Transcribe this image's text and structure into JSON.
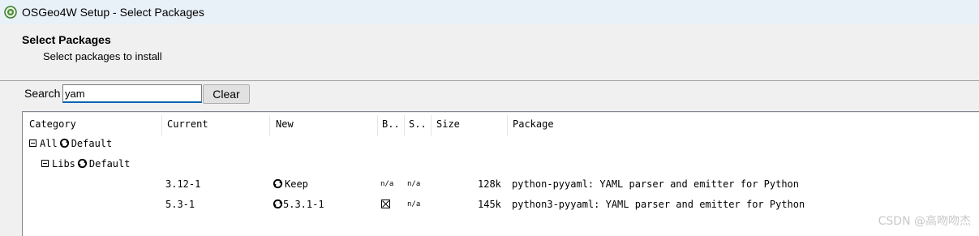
{
  "window": {
    "title": "OSGeo4W Setup - Select Packages",
    "icon": "osgeo4w-logo-icon"
  },
  "header": {
    "title": "Select Packages",
    "subtitle": "Select packages to install"
  },
  "search": {
    "label": "Search",
    "value": "yam",
    "clear_label": "Clear"
  },
  "columns": [
    "Category",
    "Current",
    "New",
    "B..",
    "S..",
    "Size",
    "Package"
  ],
  "tree": [
    {
      "label": "All",
      "action": "Default"
    },
    {
      "label": "Libs",
      "action": "Default"
    }
  ],
  "packages": [
    {
      "current": "3.12-1",
      "new": "Keep",
      "binary": "n/a",
      "source": "n/a",
      "size": "128k",
      "package": "python-pyyaml: YAML parser and emitter for Python"
    },
    {
      "current": "5.3-1",
      "new": "5.3.1-1",
      "binary": "checked",
      "source": "n/a",
      "size": "145k",
      "package": "python3-pyyaml: YAML parser and emitter for Python"
    }
  ],
  "watermark": "CSDN @高吻吻杰",
  "colors": {
    "titlebar": "#e9f1f8",
    "input_focus": "#0063b1",
    "background": "#f0f0f0"
  }
}
